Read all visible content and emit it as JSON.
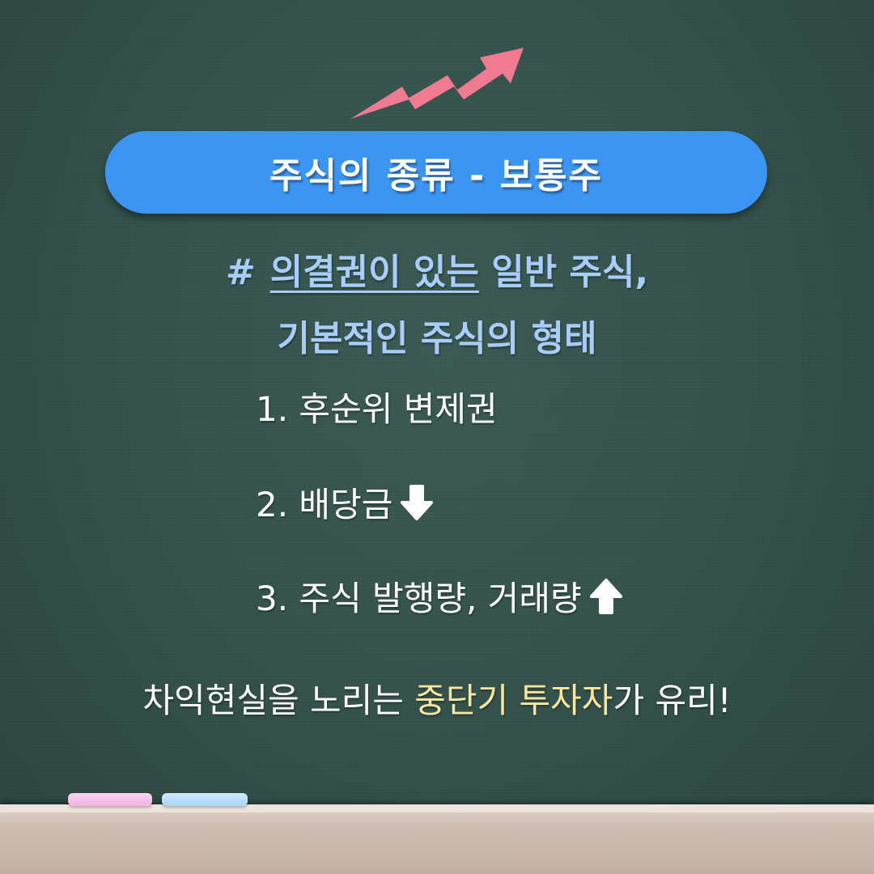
{
  "title": "주식의 종류 - 보통주",
  "subtitle": {
    "hash": "#",
    "line1_underlined": "의결권이 있는",
    "line1_rest": " 일반 주식,",
    "line2": "기본적인 주식의 형태"
  },
  "items": [
    {
      "text": "1. 후순위 변제권",
      "icon": ""
    },
    {
      "text": "2. 배당금",
      "icon": "down-arrow-icon"
    },
    {
      "text": "3. 주식 발행량, 거래량",
      "icon": "up-arrow-icon"
    }
  ],
  "conclusion": {
    "part1": "차익현실을 노리는 ",
    "highlight1": "중단기",
    "space": " ",
    "highlight2": "투자자",
    "part2": "가 유리!"
  },
  "colors": {
    "board": "#33504a",
    "title_pill": "#3d95f3",
    "subtitle_text": "#a9cdfa",
    "highlight_text": "#f6e6a0",
    "trend_arrow": "#f07a92",
    "chalk_pink": "#f2b3e2",
    "chalk_blue": "#a9d6f5",
    "tray": "#cdbcb2"
  },
  "icons": {
    "trend": "trend-up-arrow-icon",
    "down": "down-arrow-icon",
    "up": "up-arrow-icon"
  }
}
